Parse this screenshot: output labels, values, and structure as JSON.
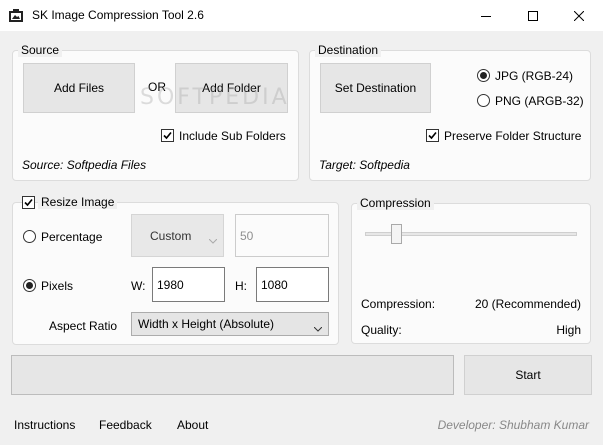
{
  "window": {
    "title": "SK Image Compression Tool 2.6",
    "controls": [
      "minimize-icon",
      "maximize-icon",
      "close-icon"
    ]
  },
  "source": {
    "legend": "Source",
    "add_files": "Add Files",
    "or": "OR",
    "add_folder": "Add Folder",
    "include_sub_folders": {
      "label": "Include Sub Folders",
      "checked": true
    },
    "status": "Source: Softpedia Files"
  },
  "destination": {
    "legend": "Destination",
    "set_destination": "Set Destination",
    "formats": [
      {
        "label": "JPG (RGB-24)",
        "selected": true
      },
      {
        "label": "PNG (ARGB-32)",
        "selected": false
      }
    ],
    "preserve_structure": {
      "label": "Preserve Folder Structure",
      "checked": true
    },
    "status": "Target: Softpedia"
  },
  "resize": {
    "legend": "Resize Image",
    "enabled": true,
    "percentage": {
      "label": "Percentage",
      "selected": false,
      "preset": "Custom",
      "value": "50"
    },
    "pixels": {
      "label": "Pixels",
      "selected": true,
      "w_label": "W:",
      "w_value": "1980",
      "h_label": "H:",
      "h_value": "1080"
    },
    "aspect_ratio": {
      "label": "Aspect Ratio",
      "value": "Width x Height (Absolute)"
    }
  },
  "compression": {
    "legend": "Compression",
    "slider_fraction": 0.13,
    "compression_label": "Compression:",
    "compression_value": "20 (Recommended)",
    "quality_label": "Quality:",
    "quality_value": "High"
  },
  "progress": {
    "fraction": 0
  },
  "start": "Start",
  "footer": {
    "links": [
      "Instructions",
      "Feedback",
      "About"
    ],
    "developer": "Developer: Shubham Kumar"
  },
  "watermark": "SOFTPEDIA",
  "colors": {
    "titlebar": "#ffffff",
    "background": "#f0f0f0",
    "button": "#e1e1e1"
  }
}
